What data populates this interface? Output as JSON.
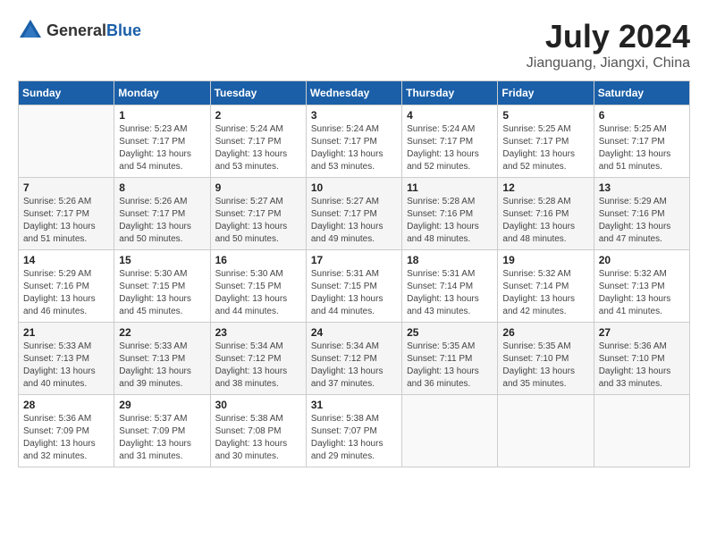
{
  "header": {
    "logo_general": "General",
    "logo_blue": "Blue",
    "title": "July 2024",
    "location": "Jianguang, Jiangxi, China"
  },
  "calendar": {
    "weekdays": [
      "Sunday",
      "Monday",
      "Tuesday",
      "Wednesday",
      "Thursday",
      "Friday",
      "Saturday"
    ],
    "weeks": [
      [
        {
          "day": "",
          "sunrise": "",
          "sunset": "",
          "daylight": "",
          "empty": true
        },
        {
          "day": "1",
          "sunrise": "Sunrise: 5:23 AM",
          "sunset": "Sunset: 7:17 PM",
          "daylight": "Daylight: 13 hours and 54 minutes."
        },
        {
          "day": "2",
          "sunrise": "Sunrise: 5:24 AM",
          "sunset": "Sunset: 7:17 PM",
          "daylight": "Daylight: 13 hours and 53 minutes."
        },
        {
          "day": "3",
          "sunrise": "Sunrise: 5:24 AM",
          "sunset": "Sunset: 7:17 PM",
          "daylight": "Daylight: 13 hours and 53 minutes."
        },
        {
          "day": "4",
          "sunrise": "Sunrise: 5:24 AM",
          "sunset": "Sunset: 7:17 PM",
          "daylight": "Daylight: 13 hours and 52 minutes."
        },
        {
          "day": "5",
          "sunrise": "Sunrise: 5:25 AM",
          "sunset": "Sunset: 7:17 PM",
          "daylight": "Daylight: 13 hours and 52 minutes."
        },
        {
          "day": "6",
          "sunrise": "Sunrise: 5:25 AM",
          "sunset": "Sunset: 7:17 PM",
          "daylight": "Daylight: 13 hours and 51 minutes."
        }
      ],
      [
        {
          "day": "7",
          "sunrise": "Sunrise: 5:26 AM",
          "sunset": "Sunset: 7:17 PM",
          "daylight": "Daylight: 13 hours and 51 minutes."
        },
        {
          "day": "8",
          "sunrise": "Sunrise: 5:26 AM",
          "sunset": "Sunset: 7:17 PM",
          "daylight": "Daylight: 13 hours and 50 minutes."
        },
        {
          "day": "9",
          "sunrise": "Sunrise: 5:27 AM",
          "sunset": "Sunset: 7:17 PM",
          "daylight": "Daylight: 13 hours and 50 minutes."
        },
        {
          "day": "10",
          "sunrise": "Sunrise: 5:27 AM",
          "sunset": "Sunset: 7:17 PM",
          "daylight": "Daylight: 13 hours and 49 minutes."
        },
        {
          "day": "11",
          "sunrise": "Sunrise: 5:28 AM",
          "sunset": "Sunset: 7:16 PM",
          "daylight": "Daylight: 13 hours and 48 minutes."
        },
        {
          "day": "12",
          "sunrise": "Sunrise: 5:28 AM",
          "sunset": "Sunset: 7:16 PM",
          "daylight": "Daylight: 13 hours and 48 minutes."
        },
        {
          "day": "13",
          "sunrise": "Sunrise: 5:29 AM",
          "sunset": "Sunset: 7:16 PM",
          "daylight": "Daylight: 13 hours and 47 minutes."
        }
      ],
      [
        {
          "day": "14",
          "sunrise": "Sunrise: 5:29 AM",
          "sunset": "Sunset: 7:16 PM",
          "daylight": "Daylight: 13 hours and 46 minutes."
        },
        {
          "day": "15",
          "sunrise": "Sunrise: 5:30 AM",
          "sunset": "Sunset: 7:15 PM",
          "daylight": "Daylight: 13 hours and 45 minutes."
        },
        {
          "day": "16",
          "sunrise": "Sunrise: 5:30 AM",
          "sunset": "Sunset: 7:15 PM",
          "daylight": "Daylight: 13 hours and 44 minutes."
        },
        {
          "day": "17",
          "sunrise": "Sunrise: 5:31 AM",
          "sunset": "Sunset: 7:15 PM",
          "daylight": "Daylight: 13 hours and 44 minutes."
        },
        {
          "day": "18",
          "sunrise": "Sunrise: 5:31 AM",
          "sunset": "Sunset: 7:14 PM",
          "daylight": "Daylight: 13 hours and 43 minutes."
        },
        {
          "day": "19",
          "sunrise": "Sunrise: 5:32 AM",
          "sunset": "Sunset: 7:14 PM",
          "daylight": "Daylight: 13 hours and 42 minutes."
        },
        {
          "day": "20",
          "sunrise": "Sunrise: 5:32 AM",
          "sunset": "Sunset: 7:13 PM",
          "daylight": "Daylight: 13 hours and 41 minutes."
        }
      ],
      [
        {
          "day": "21",
          "sunrise": "Sunrise: 5:33 AM",
          "sunset": "Sunset: 7:13 PM",
          "daylight": "Daylight: 13 hours and 40 minutes."
        },
        {
          "day": "22",
          "sunrise": "Sunrise: 5:33 AM",
          "sunset": "Sunset: 7:13 PM",
          "daylight": "Daylight: 13 hours and 39 minutes."
        },
        {
          "day": "23",
          "sunrise": "Sunrise: 5:34 AM",
          "sunset": "Sunset: 7:12 PM",
          "daylight": "Daylight: 13 hours and 38 minutes."
        },
        {
          "day": "24",
          "sunrise": "Sunrise: 5:34 AM",
          "sunset": "Sunset: 7:12 PM",
          "daylight": "Daylight: 13 hours and 37 minutes."
        },
        {
          "day": "25",
          "sunrise": "Sunrise: 5:35 AM",
          "sunset": "Sunset: 7:11 PM",
          "daylight": "Daylight: 13 hours and 36 minutes."
        },
        {
          "day": "26",
          "sunrise": "Sunrise: 5:35 AM",
          "sunset": "Sunset: 7:10 PM",
          "daylight": "Daylight: 13 hours and 35 minutes."
        },
        {
          "day": "27",
          "sunrise": "Sunrise: 5:36 AM",
          "sunset": "Sunset: 7:10 PM",
          "daylight": "Daylight: 13 hours and 33 minutes."
        }
      ],
      [
        {
          "day": "28",
          "sunrise": "Sunrise: 5:36 AM",
          "sunset": "Sunset: 7:09 PM",
          "daylight": "Daylight: 13 hours and 32 minutes."
        },
        {
          "day": "29",
          "sunrise": "Sunrise: 5:37 AM",
          "sunset": "Sunset: 7:09 PM",
          "daylight": "Daylight: 13 hours and 31 minutes."
        },
        {
          "day": "30",
          "sunrise": "Sunrise: 5:38 AM",
          "sunset": "Sunset: 7:08 PM",
          "daylight": "Daylight: 13 hours and 30 minutes."
        },
        {
          "day": "31",
          "sunrise": "Sunrise: 5:38 AM",
          "sunset": "Sunset: 7:07 PM",
          "daylight": "Daylight: 13 hours and 29 minutes."
        },
        {
          "day": "",
          "sunrise": "",
          "sunset": "",
          "daylight": "",
          "empty": true
        },
        {
          "day": "",
          "sunrise": "",
          "sunset": "",
          "daylight": "",
          "empty": true
        },
        {
          "day": "",
          "sunrise": "",
          "sunset": "",
          "daylight": "",
          "empty": true
        }
      ]
    ]
  }
}
